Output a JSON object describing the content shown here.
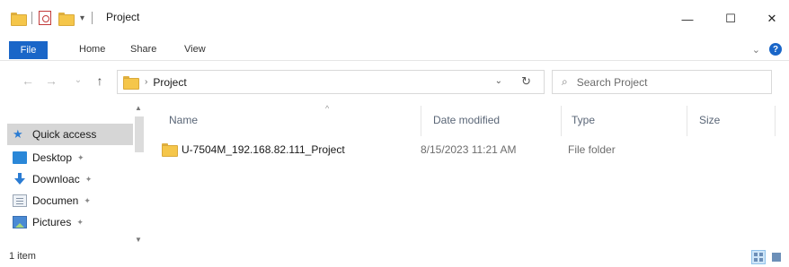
{
  "window": {
    "title": "Project",
    "qat_dropdown": "▾",
    "minimize": "—",
    "maximize": "☐",
    "close": "✕"
  },
  "ribbon": {
    "tabs": [
      "File",
      "Home",
      "Share",
      "View"
    ],
    "expand_glyph": "⌄",
    "help_glyph": "?"
  },
  "address": {
    "back": "←",
    "forward": "→",
    "recent": "⌄",
    "up": "↑",
    "separator": "›",
    "path": "Project",
    "dropdown": "⌄",
    "refresh": "↻"
  },
  "search": {
    "icon": "⌕",
    "placeholder": "Search Project"
  },
  "nav_pane": {
    "items": [
      {
        "label": "Quick access",
        "icon": "star-icon",
        "selected": true,
        "pin": ""
      },
      {
        "label": "Desktop",
        "icon": "desktop-icon",
        "selected": false,
        "pin": "✦"
      },
      {
        "label": "Downloac",
        "icon": "download-icon",
        "selected": false,
        "pin": "✦"
      },
      {
        "label": "Documen",
        "icon": "documents-icon",
        "selected": false,
        "pin": "✦"
      },
      {
        "label": "Pictures",
        "icon": "pictures-icon",
        "selected": false,
        "pin": "✦"
      }
    ],
    "scroll_up": "▲",
    "scroll_down": "▼"
  },
  "columns": {
    "name": "Name",
    "date_modified": "Date modified",
    "type": "Type",
    "size": "Size",
    "sort_indicator": "^"
  },
  "files": [
    {
      "name": "U-7504M_192.168.82.111_Project",
      "date_modified": "8/15/2023 11:21 AM",
      "type": "File folder",
      "icon": "folder-icon"
    }
  ],
  "status": {
    "item_count": "1 item"
  },
  "colors": {
    "accent": "#1a66c8",
    "folder": "#f5c64a",
    "selection": "#d6d6d6"
  }
}
